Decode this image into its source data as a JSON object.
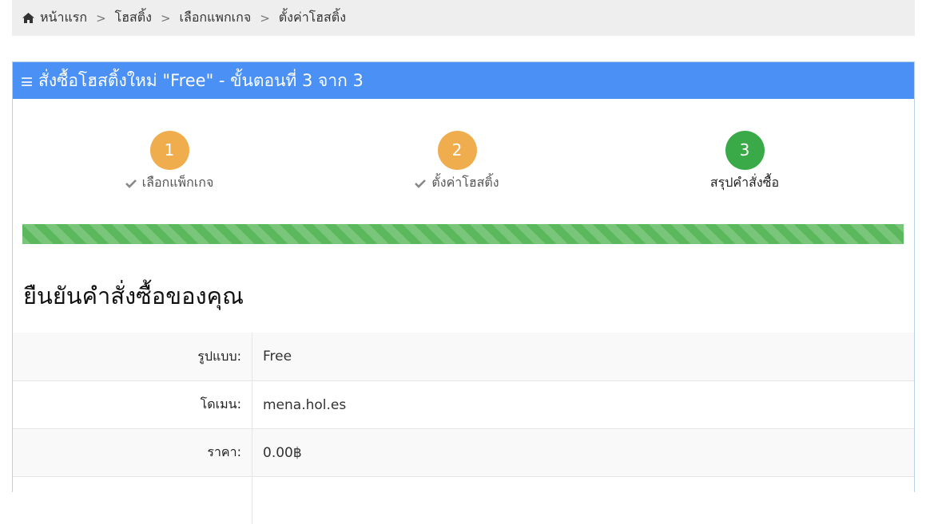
{
  "breadcrumb": {
    "items": [
      "หน้าแรก",
      "โฮสติ้ง",
      "เลือกแพกเกจ",
      "ตั้งค่าโฮสติ้ง"
    ],
    "home_icon": "home-icon",
    "separator": ">"
  },
  "panel": {
    "title": "สั่งซื้อโฮสติ้งใหม่ \"Free\" - ขั้นตอนที่ 3 จาก 3",
    "header_color": "#4b90f5",
    "menu_icon": "bars-icon"
  },
  "steps": [
    {
      "number": "1",
      "label": "เลือกแพ็กเกจ",
      "completed": true,
      "color": "#f0ad4e"
    },
    {
      "number": "2",
      "label": "ตั้งค่าโฮสติ้ง",
      "completed": true,
      "color": "#f0ad4e"
    },
    {
      "number": "3",
      "label": "สรุปคำสั่งซื้อ",
      "completed": false,
      "color": "#3aaa48"
    }
  ],
  "progress": {
    "percent": 100,
    "color": "#5cb85c"
  },
  "confirm": {
    "title": "ยืนยันคำสั่งซื้อของคุณ"
  },
  "details": [
    {
      "label": "รูปแบบ:",
      "value": "Free"
    },
    {
      "label": "โดเมน:",
      "value": "mena.hol.es"
    },
    {
      "label": "ราคา:",
      "value": "0.00฿"
    },
    {
      "label": "",
      "value": ""
    }
  ]
}
